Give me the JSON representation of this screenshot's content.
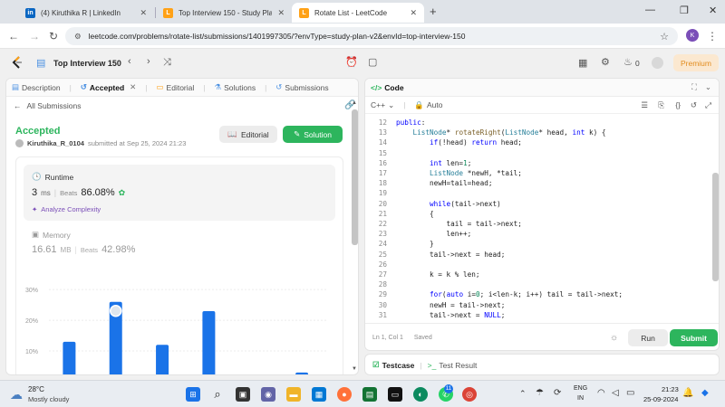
{
  "browser": {
    "tabs": [
      {
        "title": "(4) Kiruthika R | LinkedIn",
        "favicon": "in"
      },
      {
        "title": "Top Interview 150 - Study Plan",
        "favicon": "L"
      },
      {
        "title": "Rotate List - LeetCode",
        "favicon": "L"
      }
    ],
    "url": "leetcode.com/problems/rotate-list/submissions/1401997305/?envType=study-plan-v2&envId=top-interview-150",
    "profile_initial": "K"
  },
  "header": {
    "study_plan": "Top Interview 150",
    "streak": "0",
    "premium": "Premium"
  },
  "left_tabs": [
    {
      "label": "Description"
    },
    {
      "label": "Accepted"
    },
    {
      "label": "Editorial"
    },
    {
      "label": "Solutions"
    },
    {
      "label": "Submissions"
    }
  ],
  "submission": {
    "back_label": "All Submissions",
    "status": "Accepted",
    "user": "Kiruthika_R_0104",
    "submitted_text": "submitted at Sep 25, 2024 21:23",
    "editorial_label": "Editorial",
    "solution_label": "Solution"
  },
  "runtime": {
    "title": "Runtime",
    "value": "3",
    "unit": "ms",
    "beats_label": "Beats",
    "beats": "86.08%",
    "analyze": "Analyze Complexity"
  },
  "memory": {
    "title": "Memory",
    "value": "16.61",
    "unit": "MB",
    "beats_label": "Beats",
    "beats": "42.98%"
  },
  "chart_data": {
    "type": "bar",
    "yticks": [
      "30%",
      "20%",
      "10%"
    ],
    "ylim": [
      0,
      33
    ],
    "values": [
      13,
      26,
      12,
      23,
      1.5,
      3
    ],
    "highlight_index": 1,
    "color": "#1a73e8"
  },
  "code_panel": {
    "title": "Code",
    "language": "C++",
    "mode": "Auto",
    "status": "Ln 1, Col 1",
    "saved": "Saved",
    "run": "Run",
    "submit": "Submit"
  },
  "code_lines": [
    {
      "n": "12",
      "t": "public:"
    },
    {
      "n": "13",
      "t": "    ListNode* rotateRight(ListNode* head, int k) {"
    },
    {
      "n": "14",
      "t": "        if(!head) return head;"
    },
    {
      "n": "15",
      "t": ""
    },
    {
      "n": "16",
      "t": "        int len=1;"
    },
    {
      "n": "17",
      "t": "        ListNode *newH, *tail;"
    },
    {
      "n": "18",
      "t": "        newH=tail=head;"
    },
    {
      "n": "19",
      "t": ""
    },
    {
      "n": "20",
      "t": "        while(tail->next)"
    },
    {
      "n": "21",
      "t": "        {"
    },
    {
      "n": "22",
      "t": "            tail = tail->next;"
    },
    {
      "n": "23",
      "t": "            len++;"
    },
    {
      "n": "24",
      "t": "        }"
    },
    {
      "n": "25",
      "t": "        tail->next = head;"
    },
    {
      "n": "26",
      "t": ""
    },
    {
      "n": "27",
      "t": "        k = k % len;"
    },
    {
      "n": "28",
      "t": ""
    },
    {
      "n": "29",
      "t": "        for(auto i=0; i<len-k; i++) tail = tail->next;"
    },
    {
      "n": "30",
      "t": "        newH = tail->next;"
    },
    {
      "n": "31",
      "t": "        tail->next = NULL;"
    }
  ],
  "bottom_tabs": {
    "testcase": "Testcase",
    "result": "Test Result"
  },
  "taskbar": {
    "temp": "28°C",
    "weather": "Mostly cloudy",
    "lang1": "ENG",
    "lang2": "IN",
    "time": "21:23",
    "date": "25-09-2024",
    "badge": "11"
  },
  "colors": {
    "accent_green": "#2db55d",
    "premium_orange": "#e28c1e"
  }
}
